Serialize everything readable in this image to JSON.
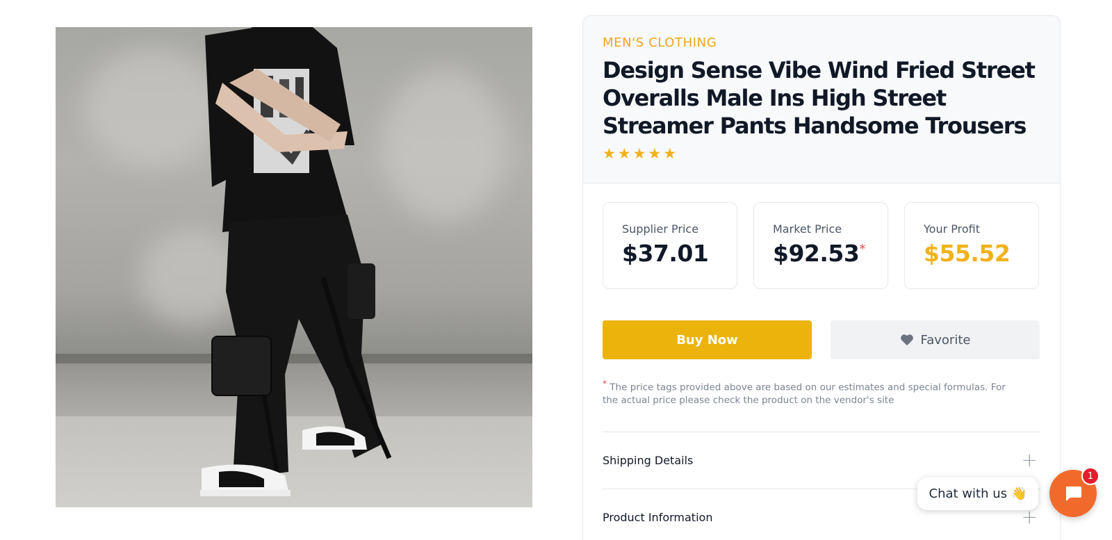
{
  "product": {
    "image_alt": "Model wearing black streetwear overalls pants against concrete wall",
    "category": "MEN'S CLOTHING",
    "title": "Design Sense Vibe Wind Fried Street Overalls Male Ins High Street Streamer Pants Handsome Trousers",
    "rating_stars": 5,
    "star_glyph": "★",
    "star_color": "#f0b21b"
  },
  "prices": {
    "supplier": {
      "label": "Supplier Price",
      "value": "$37.01"
    },
    "market": {
      "label": "Market Price",
      "value": "$92.53",
      "asterisk": "*"
    },
    "profit": {
      "label": "Your Profit",
      "value": "$55.52"
    }
  },
  "actions": {
    "buy_label": "Buy Now",
    "favorite_label": "Favorite",
    "buy_color": "#ebb30b"
  },
  "note": {
    "asterisk": "*",
    "text": "The price tags provided above are based on our estimates and special formulas. For the actual price please check the product on the vendor's site"
  },
  "accordion": [
    {
      "label": "Shipping Details",
      "icon": "plus-icon"
    },
    {
      "label": "Product Information",
      "icon": "plus-icon"
    }
  ],
  "chat": {
    "label": "Chat with us",
    "emoji": "👋",
    "badge_count": "1",
    "fab_color": "#f26a2b"
  }
}
